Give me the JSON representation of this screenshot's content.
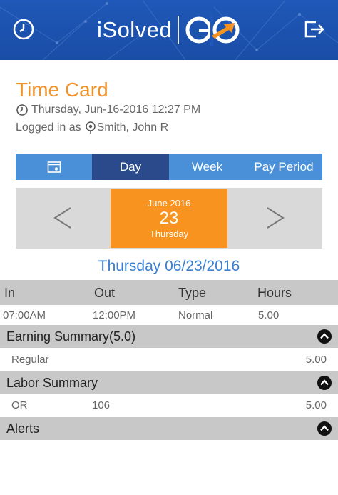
{
  "header": {
    "brand_name": "iSolved",
    "brand_logo": "GO",
    "left_icon": "clock-icon",
    "right_icon": "logout-icon"
  },
  "page": {
    "title": "Time Card",
    "datetime": "Thursday, Jun-16-2016 12:27 PM",
    "logged_in_prefix": "Logged in as",
    "user": "Smith, John R"
  },
  "tabs": {
    "calendar_icon": "calendar-icon",
    "day": "Day",
    "week": "Week",
    "pay_period": "Pay Period",
    "active": "Day"
  },
  "date_picker": {
    "month": "June 2016",
    "day": "23",
    "weekday": "Thursday",
    "prev": "<",
    "next": ">"
  },
  "day_heading": "Thursday 06/23/2016",
  "punch_table": {
    "headers": [
      "In",
      "Out",
      "Type",
      "Hours"
    ],
    "rows": [
      [
        "07:00AM",
        "12:00PM",
        "Normal",
        "5.00"
      ]
    ]
  },
  "earning_summary": {
    "title": "Earning Summary(5.0)",
    "items": [
      {
        "label": "Regular",
        "value": "5.00"
      }
    ]
  },
  "labor_summary": {
    "title": "Labor Summary",
    "items": [
      {
        "label": "OR",
        "code": "106",
        "value": "5.00"
      }
    ]
  },
  "alerts": {
    "title": "Alerts"
  },
  "colors": {
    "header_blue": "#1f58b8",
    "title_orange": "#f0922a",
    "tab_blue": "#4a90d9",
    "tab_active": "#2a4a8c",
    "date_orange": "#f7931e",
    "heading_blue": "#3a7fd0",
    "section_gray": "#c8c8c8"
  }
}
